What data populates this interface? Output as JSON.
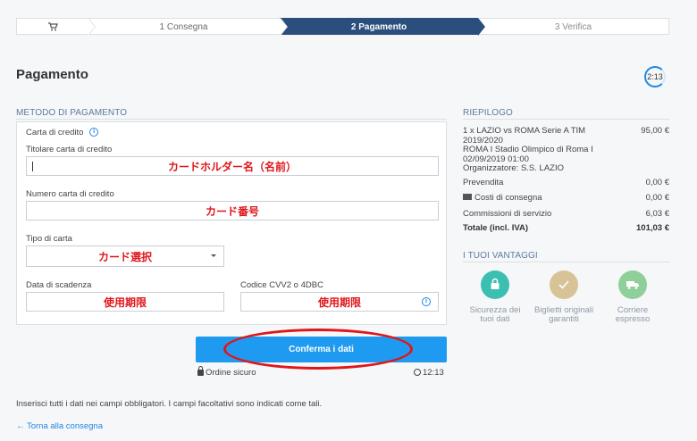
{
  "stepper": {
    "cart_icon": "cart-icon",
    "step1": "1 Consegna",
    "step2": "2 Pagamento",
    "step3": "3 Verifica"
  },
  "page_title": "Pagamento",
  "timer_circle": "2:13",
  "payment": {
    "section": "METODO DI PAGAMENTO",
    "card_type_label": "Carta di credito",
    "holder_label": "Titolare carta di credito",
    "holder_value": "カードホルダー名（名前）",
    "number_label": "Numero carta di credito",
    "number_value": "カード番号",
    "type_label": "Tipo di carta",
    "type_value": "カード選択",
    "expiry_label": "Data di scadenza",
    "expiry_value": "使用期限",
    "cvv_label": "Codice CVV2 o 4DBC",
    "cvv_value": "使用期限"
  },
  "confirm_label": "Conferma i dati",
  "secure_label": "Ordine sicuro",
  "timer_small": "12:13",
  "note": "Inserisci tutti i dati nei campi obbligatori. I campi facoltativi sono indicati come tali.",
  "back_link": "← Torna alla consegna",
  "summary": {
    "section": "RIEPILOGO",
    "item_line1": "1 x LAZIO vs ROMA Serie A TIM",
    "item_line2": "2019/2020",
    "item_line3": "ROMA I Stadio Olimpico di Roma I",
    "item_line4": "02/09/2019 01:00",
    "item_line5": "Organizzatore: S.S. LAZIO",
    "item_price": "95,00 €",
    "presale_label": "Prevendita",
    "presale_value": "0,00 €",
    "shipping_label": "Costi di consegna",
    "shipping_value": "0,00 €",
    "service_label": "Commissioni di servizio",
    "service_value": "6,03 €",
    "total_label": "Totale (incl. IVA)",
    "total_value": "101,03 €"
  },
  "advantages": {
    "section": "I TUOI VANTAGGI",
    "items": [
      {
        "line1": "Sicurezza dei",
        "line2": "tuoi dati",
        "icon": "lock-icon",
        "color": "#3bbfb0"
      },
      {
        "line1": "Biglietti originali",
        "line2": "garantiti",
        "icon": "check-icon",
        "color": "#d7c396"
      },
      {
        "line1": "Corriere",
        "line2": "espresso",
        "icon": "truck-icon",
        "color": "#8fcf9a"
      }
    ]
  }
}
